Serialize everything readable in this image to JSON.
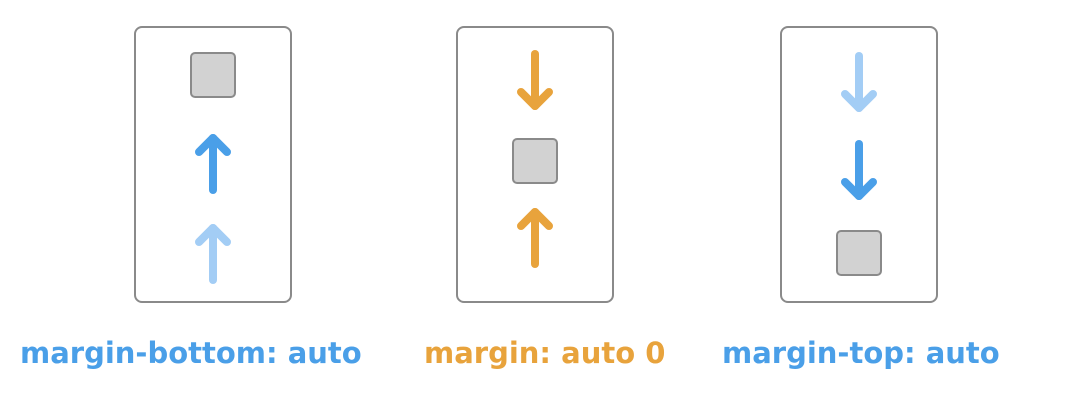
{
  "colors": {
    "blue": "#4a9fe8",
    "light_blue": "#a3cdf5",
    "orange": "#e8a33c"
  },
  "panels": [
    {
      "caption": "margin-bottom: auto",
      "caption_color": "#4a9fe8",
      "arrows": [
        {
          "direction": "up",
          "color": "#4a9fe8"
        },
        {
          "direction": "up",
          "color": "#a3cdf5"
        }
      ]
    },
    {
      "caption": "margin: auto 0",
      "caption_color": "#e8a33c",
      "arrows": [
        {
          "direction": "down",
          "color": "#e8a33c"
        },
        {
          "direction": "up",
          "color": "#e8a33c"
        }
      ]
    },
    {
      "caption": "margin-top: auto",
      "caption_color": "#4a9fe8",
      "arrows": [
        {
          "direction": "down",
          "color": "#a3cdf5"
        },
        {
          "direction": "down",
          "color": "#4a9fe8"
        }
      ]
    }
  ]
}
